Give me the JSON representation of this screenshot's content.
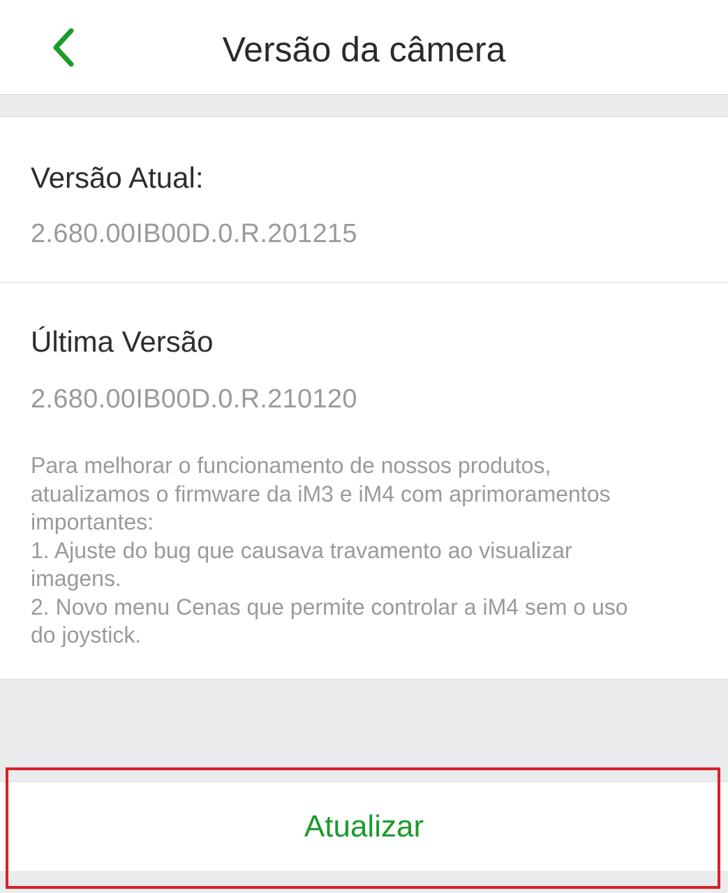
{
  "header": {
    "title": "Versão da câmera",
    "back_icon": "chevron-left-icon",
    "accent_color": "#1a9b2a"
  },
  "current_version": {
    "label": "Versão Atual:",
    "value": "2.680.00IB00D.0.R.201215"
  },
  "latest_version": {
    "label": "Última Versão",
    "value": "2.680.00IB00D.0.R.210120",
    "notes": "Para melhorar o funcionamento de nossos produtos,\natualizamos o firmware da iM3 e iM4 com aprimoramentos\nimportantes:\n1. Ajuste do bug que causava travamento ao visualizar\nimagens.\n2. Novo menu Cenas que permite controlar a iM4 sem o uso\ndo joystick."
  },
  "actions": {
    "update_label": "Atualizar",
    "update_color": "#1a9b2a",
    "highlight_color": "#d8202a"
  }
}
